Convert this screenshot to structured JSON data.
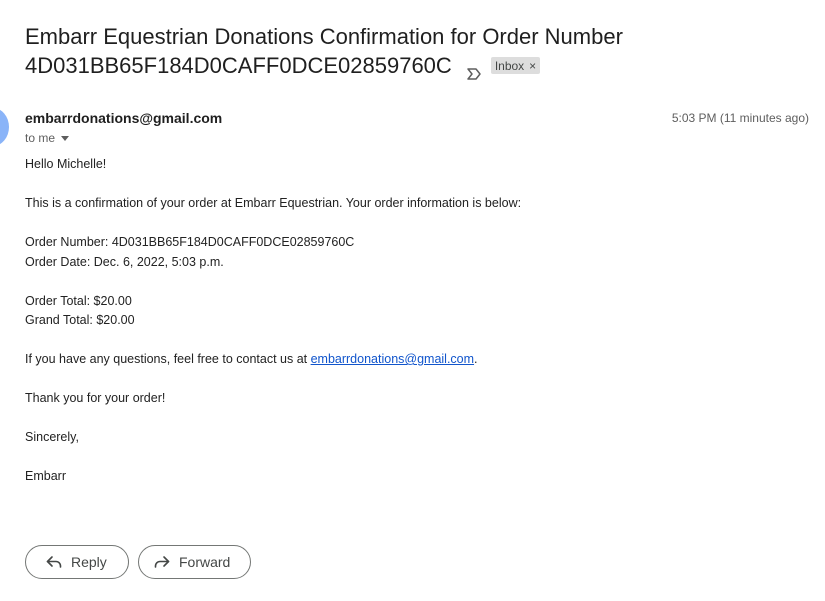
{
  "email": {
    "subject_line1": "Embarr Equestrian Donations Confirmation for Order Number",
    "subject_line2": "4D031BB65F184D0CAFF0DCE02859760C",
    "label": "Inbox",
    "label_remove": "×",
    "sender": "embarrdonations@gmail.com",
    "timestamp": "5:03 PM (11 minutes ago)",
    "recipient": "to me",
    "body": {
      "greeting": "Hello Michelle!",
      "intro": "This is a confirmation of your order at Embarr Equestrian. Your order information is below:",
      "order_number": "Order Number: 4D031BB65F184D0CAFF0DCE02859760C",
      "order_date": "Order Date: Dec. 6, 2022, 5:03 p.m.",
      "order_total": "Order Total: $20.00",
      "grand_total": "Grand Total: $20.00",
      "questions_prefix": "If you have any questions, feel free to contact us at ",
      "contact_link": "embarrdonations@gmail.com",
      "questions_suffix": ".",
      "thanks": "Thank you for your order!",
      "closing": "Sincerely,",
      "signature": "Embarr"
    }
  },
  "actions": {
    "reply_label": "Reply",
    "forward_label": "Forward"
  },
  "icons": {
    "importance": "importance-marker-icon",
    "reply": "reply-arrow-icon",
    "forward": "forward-arrow-icon",
    "details": "chevron-down-icon"
  },
  "colors": {
    "link": "#1155cc",
    "avatar": "#8ab4f8",
    "label_chip": "#dddddd"
  }
}
